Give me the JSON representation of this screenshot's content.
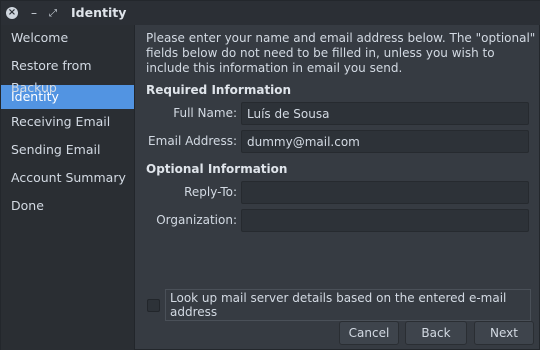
{
  "window": {
    "title": "Identity",
    "close_glyph": "×",
    "min_glyph": "–",
    "max_glyph": "⤢"
  },
  "sidebar": {
    "items": [
      {
        "label": "Welcome"
      },
      {
        "label": "Restore from Backup"
      },
      {
        "label": "Identity"
      },
      {
        "label": "Receiving Email"
      },
      {
        "label": "Sending Email"
      },
      {
        "label": "Account Summary"
      },
      {
        "label": "Done"
      }
    ],
    "active_index": 2
  },
  "main": {
    "intro": "Please enter your name and email address below. The \"optional\" fields below do not need to be filled in, unless you wish to include this information in email you send.",
    "required_heading": "Required Information",
    "optional_heading": "Optional Information",
    "fields": {
      "full_name": {
        "label": "Full Name:",
        "value": "Luís de Sousa"
      },
      "email": {
        "label": "Email Address:",
        "value": "dummy@mail.com"
      },
      "reply_to": {
        "label": "Reply-To:",
        "value": ""
      },
      "organization": {
        "label": "Organization:",
        "value": ""
      }
    },
    "lookup_checkbox": {
      "label": "Look up mail server details based on the entered e-mail address",
      "checked": false
    }
  },
  "buttons": {
    "cancel": "Cancel",
    "back": "Back",
    "next": "Next"
  },
  "colors": {
    "accent": "#5294e2",
    "background": "#363b42",
    "sidebar": "#2a2e33"
  }
}
